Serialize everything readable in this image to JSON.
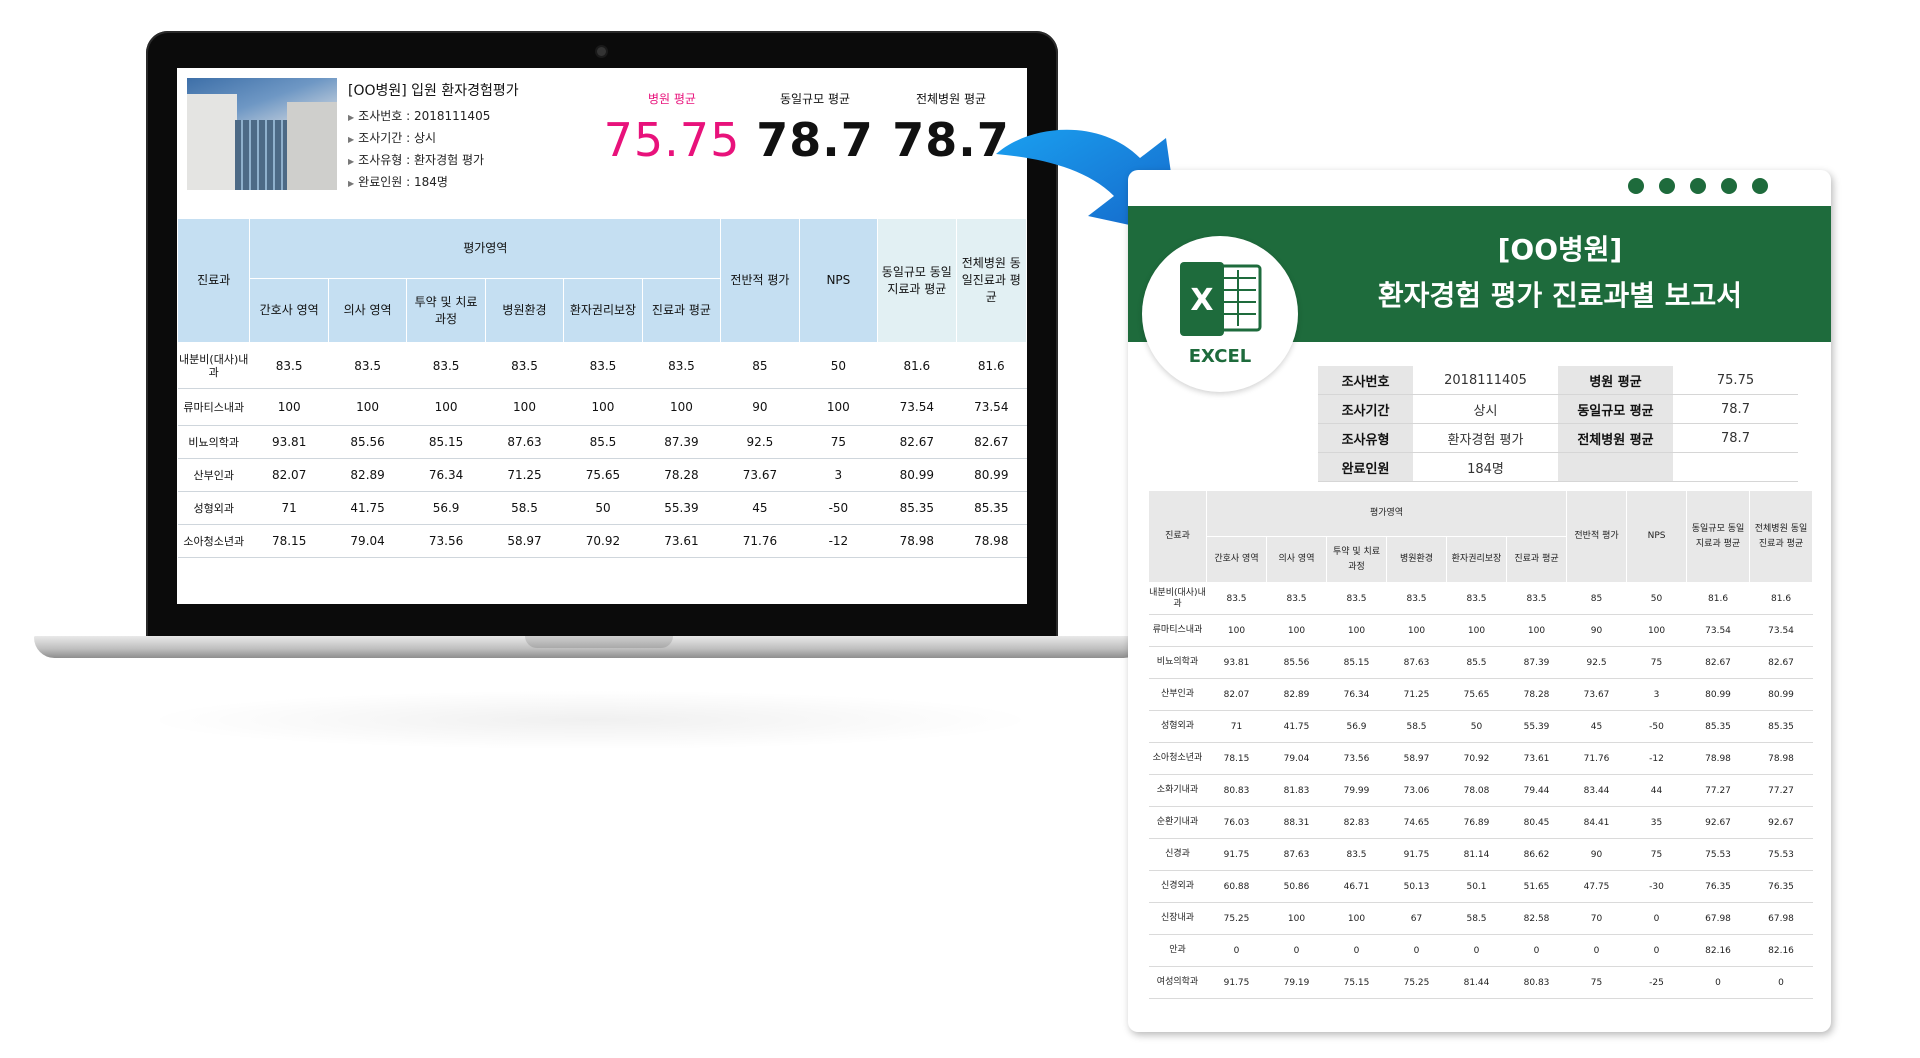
{
  "laptop": {
    "title": "[OO병원] 입원 환자경험평가",
    "info": [
      {
        "label": "조사번호 : 2018111405"
      },
      {
        "label": "조사기간 : 상시"
      },
      {
        "label": "조사유형 : 환자경험 평가"
      },
      {
        "label": "완료인원 : 184명"
      }
    ],
    "scores": [
      {
        "label": "병원 평균",
        "value": "75.75"
      },
      {
        "label": "동일규모 평균",
        "value": "78.7"
      },
      {
        "label": "전체병원 평균",
        "value": "78.7"
      }
    ],
    "table": {
      "dept_header": "진료과",
      "group_header": "평가영역",
      "sub_headers": [
        "간호사 영역",
        "의사 영역",
        "투약 및 치료 과정",
        "병원환경",
        "환자권리보장",
        "진료과 평균"
      ],
      "overall_header": "전반적 평가",
      "nps_header": "NPS",
      "same_size_header": "동일규모 동일지료과 평균",
      "all_hosp_header": "전체병원 동일진료과 평균",
      "rows": [
        [
          "내분비(대사)내과",
          "83.5",
          "83.5",
          "83.5",
          "83.5",
          "83.5",
          "83.5",
          "85",
          "50",
          "81.6",
          "81.6"
        ],
        [
          "류마티스내과",
          "100",
          "100",
          "100",
          "100",
          "100",
          "100",
          "90",
          "100",
          "73.54",
          "73.54"
        ],
        [
          "비뇨의학과",
          "93.81",
          "85.56",
          "85.15",
          "87.63",
          "85.5",
          "87.39",
          "92.5",
          "75",
          "82.67",
          "82.67"
        ],
        [
          "산부인과",
          "82.07",
          "82.89",
          "76.34",
          "71.25",
          "75.65",
          "78.28",
          "73.67",
          "3",
          "80.99",
          "80.99"
        ],
        [
          "성형외과",
          "71",
          "41.75",
          "56.9",
          "58.5",
          "50",
          "55.39",
          "45",
          "-50",
          "85.35",
          "85.35"
        ],
        [
          "소아청소년과",
          "78.15",
          "79.04",
          "73.56",
          "58.97",
          "70.92",
          "73.61",
          "71.76",
          "-12",
          "78.98",
          "78.98"
        ]
      ]
    }
  },
  "report": {
    "title_line1": "[OO병원]",
    "title_line2": "환자경험 평가 진료과별 보고서",
    "excel_label": "EXCEL",
    "summary": [
      {
        "k1": "조사번호",
        "v1": "2018111405",
        "k2": "병원 평균",
        "v2": "75.75"
      },
      {
        "k1": "조사기간",
        "v1": "상시",
        "k2": "동일규모 평균",
        "v2": "78.7"
      },
      {
        "k1": "조사유형",
        "v1": "환자경험 평가",
        "k2": "전체병원 평균",
        "v2": "78.7"
      },
      {
        "k1": "완료인원",
        "v1": "184명",
        "k2": "",
        "v2": ""
      }
    ],
    "table": {
      "dept_header": "진료과",
      "group_header": "평가영역",
      "sub_headers": [
        "간호사 영역",
        "의사 영역",
        "투약 및 치료 과정",
        "병원환경",
        "환자권리보장",
        "진료과 평균"
      ],
      "overall_header": "전반적 평가",
      "nps_header": "NPS",
      "same_size_header": "동일규모 동일지료과 평균",
      "all_hosp_header": "전체병원 동일진료과 평균",
      "rows": [
        [
          "내분비(대사)내과",
          "83.5",
          "83.5",
          "83.5",
          "83.5",
          "83.5",
          "83.5",
          "85",
          "50",
          "81.6",
          "81.6"
        ],
        [
          "류마티스내과",
          "100",
          "100",
          "100",
          "100",
          "100",
          "100",
          "90",
          "100",
          "73.54",
          "73.54"
        ],
        [
          "비뇨의학과",
          "93.81",
          "85.56",
          "85.15",
          "87.63",
          "85.5",
          "87.39",
          "92.5",
          "75",
          "82.67",
          "82.67"
        ],
        [
          "산부인과",
          "82.07",
          "82.89",
          "76.34",
          "71.25",
          "75.65",
          "78.28",
          "73.67",
          "3",
          "80.99",
          "80.99"
        ],
        [
          "성형외과",
          "71",
          "41.75",
          "56.9",
          "58.5",
          "50",
          "55.39",
          "45",
          "-50",
          "85.35",
          "85.35"
        ],
        [
          "소아청소년과",
          "78.15",
          "79.04",
          "73.56",
          "58.97",
          "70.92",
          "73.61",
          "71.76",
          "-12",
          "78.98",
          "78.98"
        ],
        [
          "소화기내과",
          "80.83",
          "81.83",
          "79.99",
          "73.06",
          "78.08",
          "79.44",
          "83.44",
          "44",
          "77.27",
          "77.27"
        ],
        [
          "순환기내과",
          "76.03",
          "88.31",
          "82.83",
          "74.65",
          "76.89",
          "80.45",
          "84.41",
          "35",
          "92.67",
          "92.67"
        ],
        [
          "신경과",
          "91.75",
          "87.63",
          "83.5",
          "91.75",
          "81.14",
          "86.62",
          "90",
          "75",
          "75.53",
          "75.53"
        ],
        [
          "신경외과",
          "60.88",
          "50.86",
          "46.71",
          "50.13",
          "50.1",
          "51.65",
          "47.75",
          "-30",
          "76.35",
          "76.35"
        ],
        [
          "신장내과",
          "75.25",
          "100",
          "100",
          "67",
          "58.5",
          "82.58",
          "70",
          "0",
          "67.98",
          "67.98"
        ],
        [
          "안과",
          "0",
          "0",
          "0",
          "0",
          "0",
          "0",
          "0",
          "0",
          "82.16",
          "82.16"
        ],
        [
          "여성의학과",
          "91.75",
          "79.19",
          "75.15",
          "75.25",
          "81.44",
          "80.83",
          "75",
          "-25",
          "0",
          "0"
        ]
      ]
    }
  }
}
